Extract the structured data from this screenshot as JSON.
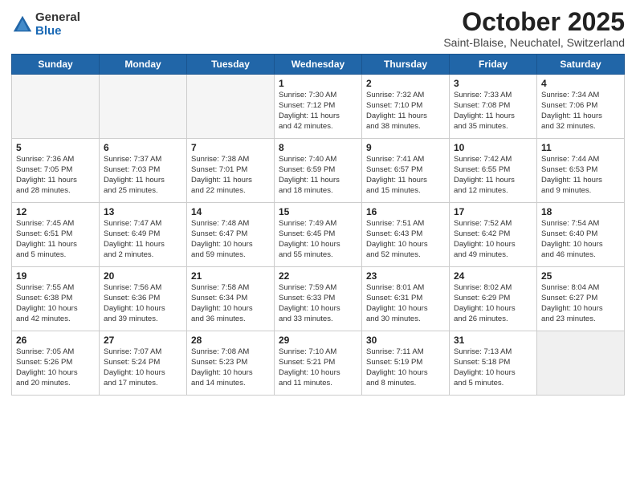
{
  "logo": {
    "general": "General",
    "blue": "Blue"
  },
  "title": "October 2025",
  "subtitle": "Saint-Blaise, Neuchatel, Switzerland",
  "days": [
    "Sunday",
    "Monday",
    "Tuesday",
    "Wednesday",
    "Thursday",
    "Friday",
    "Saturday"
  ],
  "weeks": [
    [
      {
        "num": "",
        "info": "",
        "empty": true
      },
      {
        "num": "",
        "info": "",
        "empty": true
      },
      {
        "num": "",
        "info": "",
        "empty": true
      },
      {
        "num": "1",
        "info": "Sunrise: 7:30 AM\nSunset: 7:12 PM\nDaylight: 11 hours\nand 42 minutes."
      },
      {
        "num": "2",
        "info": "Sunrise: 7:32 AM\nSunset: 7:10 PM\nDaylight: 11 hours\nand 38 minutes."
      },
      {
        "num": "3",
        "info": "Sunrise: 7:33 AM\nSunset: 7:08 PM\nDaylight: 11 hours\nand 35 minutes."
      },
      {
        "num": "4",
        "info": "Sunrise: 7:34 AM\nSunset: 7:06 PM\nDaylight: 11 hours\nand 32 minutes."
      }
    ],
    [
      {
        "num": "5",
        "info": "Sunrise: 7:36 AM\nSunset: 7:05 PM\nDaylight: 11 hours\nand 28 minutes."
      },
      {
        "num": "6",
        "info": "Sunrise: 7:37 AM\nSunset: 7:03 PM\nDaylight: 11 hours\nand 25 minutes."
      },
      {
        "num": "7",
        "info": "Sunrise: 7:38 AM\nSunset: 7:01 PM\nDaylight: 11 hours\nand 22 minutes."
      },
      {
        "num": "8",
        "info": "Sunrise: 7:40 AM\nSunset: 6:59 PM\nDaylight: 11 hours\nand 18 minutes."
      },
      {
        "num": "9",
        "info": "Sunrise: 7:41 AM\nSunset: 6:57 PM\nDaylight: 11 hours\nand 15 minutes."
      },
      {
        "num": "10",
        "info": "Sunrise: 7:42 AM\nSunset: 6:55 PM\nDaylight: 11 hours\nand 12 minutes."
      },
      {
        "num": "11",
        "info": "Sunrise: 7:44 AM\nSunset: 6:53 PM\nDaylight: 11 hours\nand 9 minutes."
      }
    ],
    [
      {
        "num": "12",
        "info": "Sunrise: 7:45 AM\nSunset: 6:51 PM\nDaylight: 11 hours\nand 5 minutes."
      },
      {
        "num": "13",
        "info": "Sunrise: 7:47 AM\nSunset: 6:49 PM\nDaylight: 11 hours\nand 2 minutes."
      },
      {
        "num": "14",
        "info": "Sunrise: 7:48 AM\nSunset: 6:47 PM\nDaylight: 10 hours\nand 59 minutes."
      },
      {
        "num": "15",
        "info": "Sunrise: 7:49 AM\nSunset: 6:45 PM\nDaylight: 10 hours\nand 55 minutes."
      },
      {
        "num": "16",
        "info": "Sunrise: 7:51 AM\nSunset: 6:43 PM\nDaylight: 10 hours\nand 52 minutes."
      },
      {
        "num": "17",
        "info": "Sunrise: 7:52 AM\nSunset: 6:42 PM\nDaylight: 10 hours\nand 49 minutes."
      },
      {
        "num": "18",
        "info": "Sunrise: 7:54 AM\nSunset: 6:40 PM\nDaylight: 10 hours\nand 46 minutes."
      }
    ],
    [
      {
        "num": "19",
        "info": "Sunrise: 7:55 AM\nSunset: 6:38 PM\nDaylight: 10 hours\nand 42 minutes."
      },
      {
        "num": "20",
        "info": "Sunrise: 7:56 AM\nSunset: 6:36 PM\nDaylight: 10 hours\nand 39 minutes."
      },
      {
        "num": "21",
        "info": "Sunrise: 7:58 AM\nSunset: 6:34 PM\nDaylight: 10 hours\nand 36 minutes."
      },
      {
        "num": "22",
        "info": "Sunrise: 7:59 AM\nSunset: 6:33 PM\nDaylight: 10 hours\nand 33 minutes."
      },
      {
        "num": "23",
        "info": "Sunrise: 8:01 AM\nSunset: 6:31 PM\nDaylight: 10 hours\nand 30 minutes."
      },
      {
        "num": "24",
        "info": "Sunrise: 8:02 AM\nSunset: 6:29 PM\nDaylight: 10 hours\nand 26 minutes."
      },
      {
        "num": "25",
        "info": "Sunrise: 8:04 AM\nSunset: 6:27 PM\nDaylight: 10 hours\nand 23 minutes."
      }
    ],
    [
      {
        "num": "26",
        "info": "Sunrise: 7:05 AM\nSunset: 5:26 PM\nDaylight: 10 hours\nand 20 minutes."
      },
      {
        "num": "27",
        "info": "Sunrise: 7:07 AM\nSunset: 5:24 PM\nDaylight: 10 hours\nand 17 minutes."
      },
      {
        "num": "28",
        "info": "Sunrise: 7:08 AM\nSunset: 5:23 PM\nDaylight: 10 hours\nand 14 minutes."
      },
      {
        "num": "29",
        "info": "Sunrise: 7:10 AM\nSunset: 5:21 PM\nDaylight: 10 hours\nand 11 minutes."
      },
      {
        "num": "30",
        "info": "Sunrise: 7:11 AM\nSunset: 5:19 PM\nDaylight: 10 hours\nand 8 minutes."
      },
      {
        "num": "31",
        "info": "Sunrise: 7:13 AM\nSunset: 5:18 PM\nDaylight: 10 hours\nand 5 minutes."
      },
      {
        "num": "",
        "info": "",
        "empty": true,
        "shaded": true
      }
    ]
  ]
}
